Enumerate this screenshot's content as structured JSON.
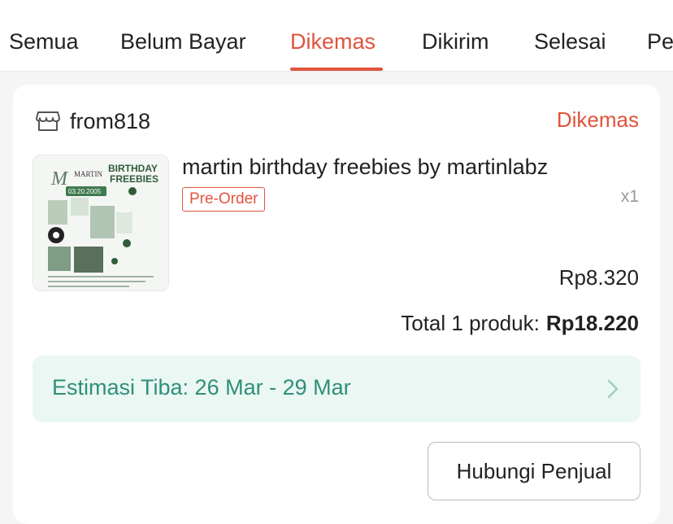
{
  "tabs": [
    {
      "label": "Semua"
    },
    {
      "label": "Belum Bayar"
    },
    {
      "label": "Dikemas"
    },
    {
      "label": "Dikirim"
    },
    {
      "label": "Selesai"
    },
    {
      "label": "Pe"
    }
  ],
  "active_tab": "Dikemas",
  "order": {
    "shop_name": "from818",
    "status": "Dikemas",
    "product": {
      "title": "martin birthday freebies by martinlabz",
      "tag": "Pre-Order",
      "quantity": "x1",
      "price": "Rp8.320",
      "image_text": {
        "name": "MARTIN",
        "line1": "BIRTHDAY",
        "line2": "FREEBIES",
        "date": "03.20.2005"
      }
    },
    "total_label": "Total 1 produk:",
    "total_amount": "Rp18.220",
    "eta": "Estimasi Tiba: 26 Mar - 29 Mar",
    "contact_button": "Hubungi Penjual"
  },
  "colors": {
    "accent": "#e0533d",
    "eta_bg": "#eaf7f3",
    "eta_text": "#2f8f78"
  },
  "icons": {
    "shop": "store-icon",
    "eta_arrow": "chevron-right-icon"
  }
}
